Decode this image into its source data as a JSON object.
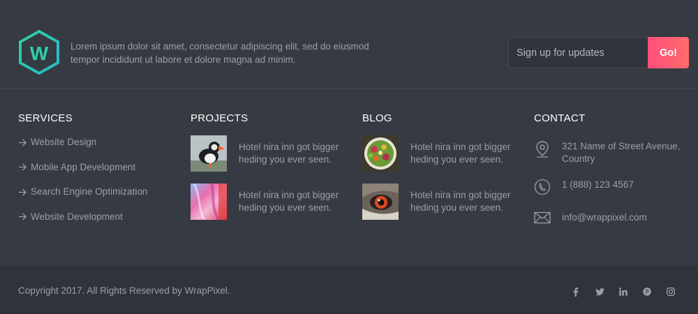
{
  "header": {
    "tagline": "Lorem ipsum dolor sit amet, consectetur adipiscing elit, sed do eiusmod tempor incididunt ut labore et dolore magna ad minim.",
    "logo_letter": "W",
    "signup_placeholder": "Sign up for updates",
    "signup_button": "Go!"
  },
  "services": {
    "title": "SERVICES",
    "items": [
      "Website Design",
      "Mobile App Development",
      "Search Engine Optimization",
      "Website Development"
    ]
  },
  "projects": {
    "title": "PROJECTS",
    "posts": [
      "Hotel nira inn got bigger heding you ever seen.",
      "Hotel nira inn got bigger heding you ever seen."
    ]
  },
  "blog": {
    "title": "BLOG",
    "posts": [
      "Hotel nira inn got bigger heding you ever seen.",
      "Hotel nira inn got bigger heding you ever seen."
    ]
  },
  "contact": {
    "title": "CONTACT",
    "address": "321 Name of Street Avenue, Country",
    "phone": "1 (888) 123 4567",
    "email": "info@wrappixel.com"
  },
  "footer": {
    "copyright": "Copyright 2017. All Rights Reserved by WrapPixel.",
    "social": [
      "facebook-icon",
      "twitter-icon",
      "linkedin-icon",
      "pinterest-icon",
      "instagram-icon"
    ]
  },
  "colors": {
    "accent_teal": "#2fcfa7",
    "button_gradient_start": "#ff4f7b",
    "button_gradient_end": "#ff6b6b",
    "background": "#363a42",
    "footer_bar": "#30333a"
  }
}
